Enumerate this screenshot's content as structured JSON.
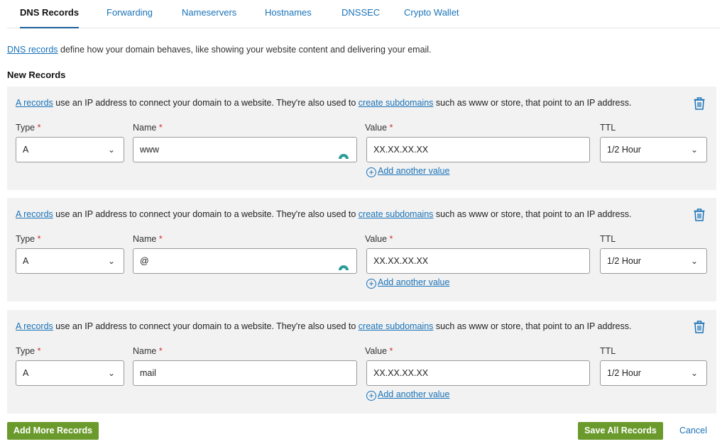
{
  "tabs": [
    "DNS Records",
    "Forwarding",
    "Nameservers",
    "Hostnames",
    "DNSSEC",
    "Crypto Wallet"
  ],
  "active_tab": "DNS Records",
  "intro": {
    "link": "DNS records",
    "text": " define how your domain behaves, like showing your website content and delivering your email."
  },
  "section_title": "New Records",
  "record_desc": {
    "link1": "A records",
    "text1": " use an IP address to connect your domain to a website. They're also used to ",
    "link2": "create subdomains",
    "text2": " such as www or store, that point to an IP address."
  },
  "labels": {
    "type": "Type",
    "name": "Name",
    "value": "Value",
    "ttl": "TTL",
    "required_mark": "*"
  },
  "add_value_label": "Add another value",
  "records": [
    {
      "type": "A",
      "name": "www",
      "value": "XX.XX.XX.XX",
      "ttl": "1/2 Hour",
      "name_icon": "arc-icon"
    },
    {
      "type": "A",
      "name": "@",
      "value": "XX.XX.XX.XX",
      "ttl": "1/2 Hour",
      "name_icon": "arc-icon"
    },
    {
      "type": "A",
      "name": "mail",
      "value": "XX.XX.XX.XX",
      "ttl": "1/2 Hour",
      "name_icon": null
    }
  ],
  "buttons": {
    "add_more": "Add More Records",
    "save_all": "Save All Records",
    "cancel": "Cancel"
  },
  "colors": {
    "accent_blue": "#1a73b8",
    "button_green": "#6b9a2c",
    "required_red": "#d0312d",
    "card_bg": "#f2f2f2",
    "arc_icon": "#2a9d9a"
  }
}
